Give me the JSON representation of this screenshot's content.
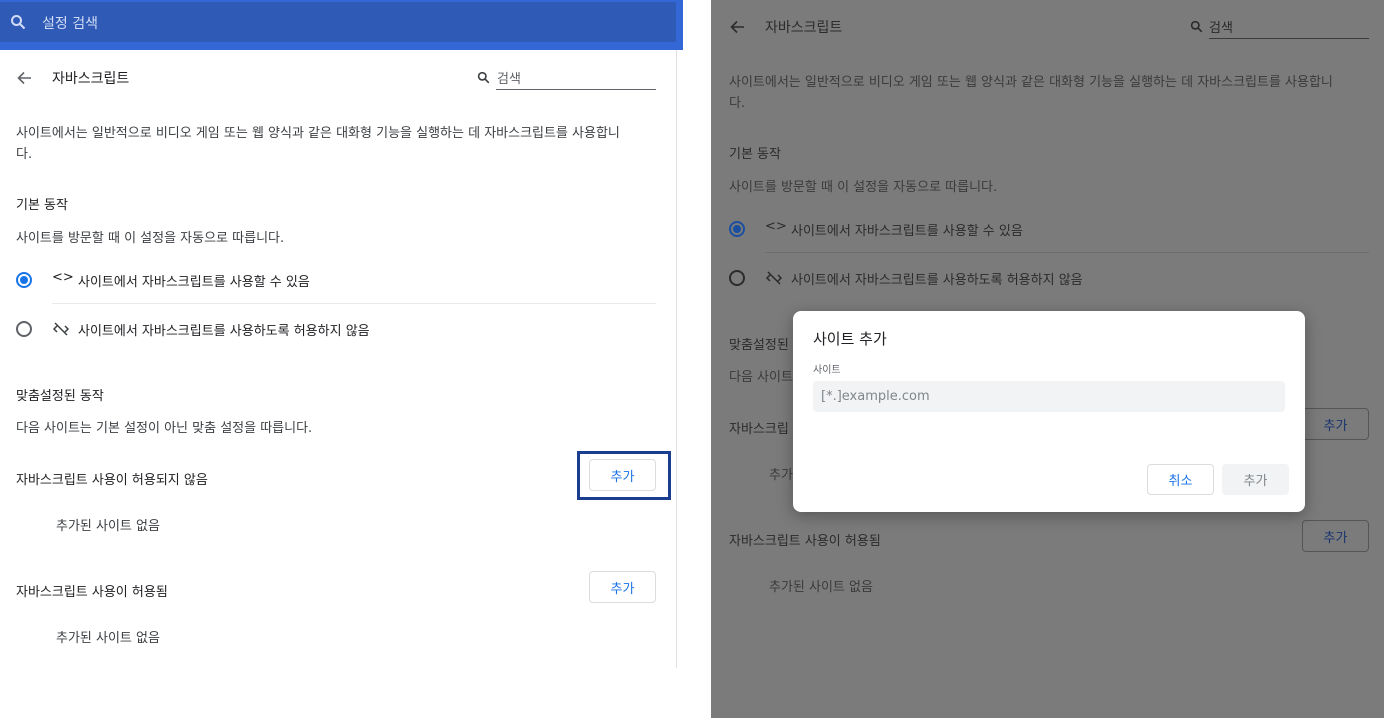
{
  "left": {
    "topbar": {
      "search_placeholder": "설정 검색"
    },
    "header": {
      "title": "자바스크립트",
      "search_placeholder": "검색"
    },
    "description_line1": "사이트에서는 일반적으로 비디오 게임 또는 웹 양식과 같은 대화형 기능을 실행하는 데 자바스크립트를 사용합니",
    "description_line2": "다.",
    "default_behavior": {
      "heading": "기본 동작",
      "subtext": "사이트를 방문할 때 이 설정을 자동으로 따릅니다.",
      "option_allow": "사이트에서 자바스크립트를 사용할 수 있음",
      "option_block": "사이트에서 자바스크립트를 사용하도록 허용하지 않음"
    },
    "custom_behavior": {
      "heading": "맞춤설정된 동작",
      "subtext": "다음 사이트는 기본 설정이 아닌 맞춤 설정을 따릅니다.",
      "blocked_label": "자바스크립트 사용이 허용되지 않음",
      "blocked_add": "추가",
      "blocked_empty": "추가된 사이트 없음",
      "allowed_label": "자바스크립트 사용이 허용됨",
      "allowed_add": "추가",
      "allowed_empty": "추가된 사이트 없음"
    }
  },
  "right": {
    "header": {
      "title": "자바스크립트",
      "search_placeholder": "검색"
    },
    "description_line1": "사이트에서는 일반적으로 비디오 게임 또는 웹 양식과 같은 대화형 기능을 실행하는 데 자바스크립트를 사용합니",
    "description_line2": "다.",
    "default_behavior": {
      "heading": "기본 동작",
      "subtext": "사이트를 방문할 때 이 설정을 자동으로 따릅니다.",
      "option_allow": "사이트에서 자바스크립트를 사용할 수 있음",
      "option_block": "사이트에서 자바스크립트를 사용하도록 허용하지 않음"
    },
    "custom_behavior": {
      "heading_partial": "맞춤설정된",
      "subtext_partial": "다음 사이트",
      "blocked_label_partial": "자바스크립",
      "blocked_add": "추가",
      "blocked_empty_partial": "추가",
      "allowed_label": "자바스크립트 사용이 허용됨",
      "allowed_add": "추가",
      "allowed_empty": "추가된 사이트 없음"
    },
    "dialog": {
      "title": "사이트 추가",
      "field_label": "사이트",
      "field_placeholder": "[*.]example.com",
      "cancel": "취소",
      "add": "추가"
    }
  },
  "colors": {
    "accent": "#1a73e8",
    "topbar": "#3367d6",
    "focus_ring": "#1a3d8f",
    "overlay": "#7b7b7b"
  }
}
